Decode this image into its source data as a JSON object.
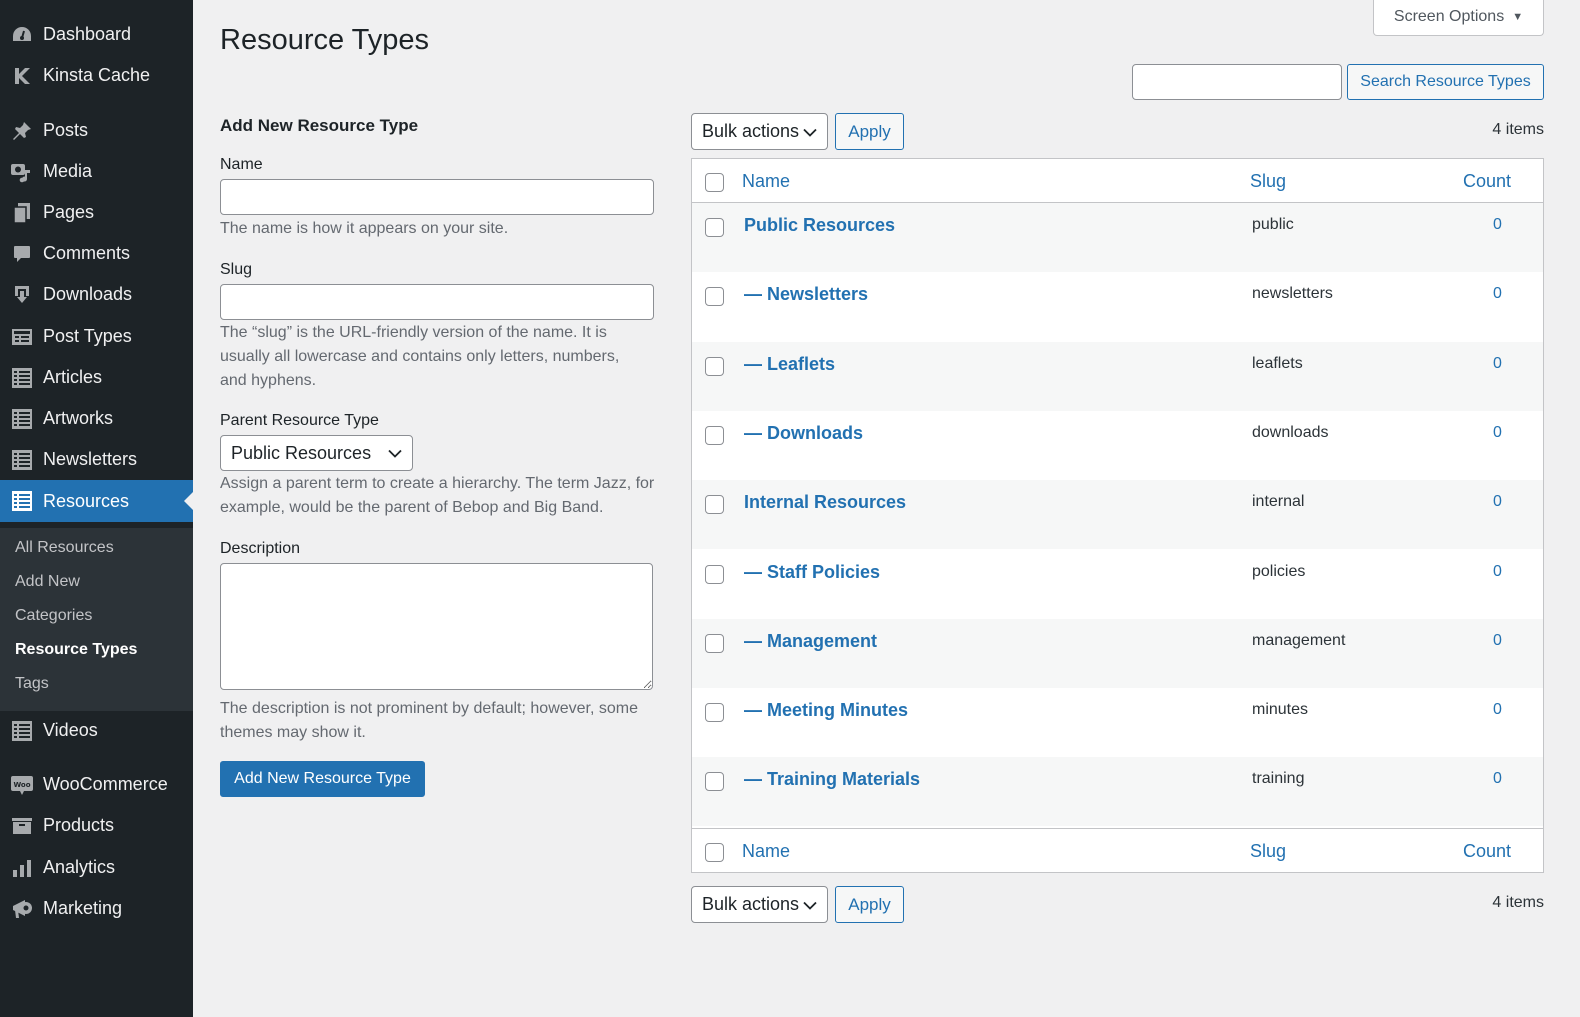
{
  "sidebar": {
    "items": [
      {
        "label": "Dashboard",
        "icon": "dashboard-icon"
      },
      {
        "label": "Kinsta Cache",
        "icon": "kinsta-icon"
      },
      {
        "label": "Posts",
        "icon": "pin-icon"
      },
      {
        "label": "Media",
        "icon": "media-icon"
      },
      {
        "label": "Pages",
        "icon": "pages-icon"
      },
      {
        "label": "Comments",
        "icon": "comment-icon"
      },
      {
        "label": "Downloads",
        "icon": "download-icon"
      },
      {
        "label": "Post Types",
        "icon": "post-types-icon"
      },
      {
        "label": "Articles",
        "icon": "list-icon"
      },
      {
        "label": "Artworks",
        "icon": "list-icon"
      },
      {
        "label": "Newsletters",
        "icon": "list-icon"
      },
      {
        "label": "Resources",
        "icon": "list-icon",
        "active": true
      },
      {
        "label": "Videos",
        "icon": "list-icon"
      },
      {
        "label": "WooCommerce",
        "icon": "woo-icon"
      },
      {
        "label": "Products",
        "icon": "archive-icon"
      },
      {
        "label": "Analytics",
        "icon": "bar-chart-icon"
      },
      {
        "label": "Marketing",
        "icon": "megaphone-icon"
      }
    ],
    "submenu": [
      {
        "label": "All Resources"
      },
      {
        "label": "Add New"
      },
      {
        "label": "Categories"
      },
      {
        "label": "Resource Types",
        "current": true
      },
      {
        "label": "Tags"
      }
    ]
  },
  "header": {
    "title": "Resource Types",
    "screen_options": "Screen Options"
  },
  "form": {
    "title": "Add New Resource Type",
    "name_label": "Name",
    "name_value": "",
    "name_help": "The name is how it appears on your site.",
    "slug_label": "Slug",
    "slug_value": "",
    "slug_help": "The “slug” is the URL-friendly version of the name. It is usually all lowercase and contains only letters, numbers, and hyphens.",
    "parent_label": "Parent Resource Type",
    "parent_selected": "Public Resources",
    "parent_help": "Assign a parent term to create a hierarchy. The term Jazz, for example, would be the parent of Bebop and Big Band.",
    "description_label": "Description",
    "description_value": "",
    "description_help": "The description is not prominent by default; however, some themes may show it.",
    "submit_label": "Add New Resource Type"
  },
  "search": {
    "value": "",
    "button_label": "Search Resource Types"
  },
  "bulk": {
    "top_selected": "Bulk actions",
    "bottom_selected": "Bulk actions",
    "apply_label": "Apply",
    "items_count": "4 items"
  },
  "table": {
    "columns": {
      "name": "Name",
      "slug": "Slug",
      "count": "Count"
    },
    "rows": [
      {
        "name": "Public Resources",
        "slug": "public",
        "count": "0"
      },
      {
        "name": "— Newsletters",
        "slug": "newsletters",
        "count": "0"
      },
      {
        "name": "— Leaflets",
        "slug": "leaflets",
        "count": "0"
      },
      {
        "name": "— Downloads",
        "slug": "downloads",
        "count": "0"
      },
      {
        "name": "Internal Resources",
        "slug": "internal",
        "count": "0"
      },
      {
        "name": "— Staff Policies",
        "slug": "policies",
        "count": "0"
      },
      {
        "name": "— Management",
        "slug": "management",
        "count": "0"
      },
      {
        "name": "— Meeting Minutes",
        "slug": "minutes",
        "count": "0"
      },
      {
        "name": "— Training Materials",
        "slug": "training",
        "count": "0"
      }
    ]
  },
  "colors": {
    "admin_bar": "#1d2327",
    "accent": "#2271b1",
    "background": "#f0f0f1"
  }
}
